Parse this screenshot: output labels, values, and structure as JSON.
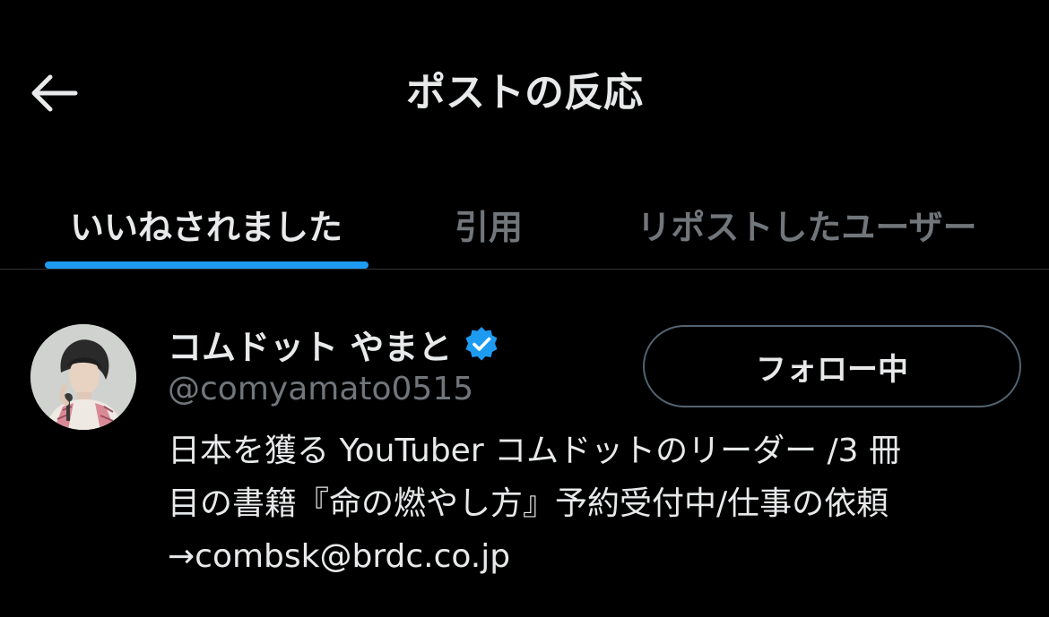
{
  "header": {
    "title": "ポストの反応",
    "back_icon": "arrow-left-icon"
  },
  "tabs": [
    {
      "label": "いいねされました",
      "active": true
    },
    {
      "label": "引用",
      "active": false
    },
    {
      "label": "リポストしたユーザー",
      "active": false
    }
  ],
  "colors": {
    "accent": "#1d9bf0",
    "text_primary": "#e7e9ea",
    "text_secondary": "#71767b",
    "background": "#000000",
    "verified": "#1d9bf0"
  },
  "user": {
    "display_name": "コムドット やまと",
    "verified_icon": "verified-badge-icon",
    "handle": "@comyamato0515",
    "follow_label": "フォロー中",
    "bio": "日本を獲る YouTuber コムドットのリーダー /3 冊\n目の書籍『命の燃やし方』予約受付中/仕事の依頼\n→combsk@brdc.co.jp"
  }
}
